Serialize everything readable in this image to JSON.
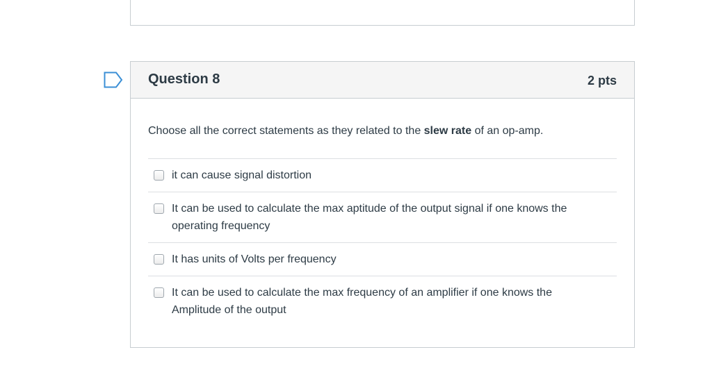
{
  "question": {
    "title": "Question 8",
    "points": "2 pts",
    "text_before": "Choose all the correct statements as they related to the ",
    "text_bold": "slew rate",
    "text_after": " of an op-amp.",
    "answers": [
      {
        "label": "it can cause signal distortion",
        "checked": false
      },
      {
        "label": "It can be used to calculate the max aptitude of the output signal if one knows the operating frequency",
        "checked": false
      },
      {
        "label": "It has units of Volts per frequency",
        "checked": false
      },
      {
        "label": "It can be used to calculate the max frequency of an amplifier if one knows the Amplitude of the output",
        "checked": false
      }
    ]
  },
  "colors": {
    "flag_stroke": "#3b8fd6",
    "border": "#c7cdd1",
    "header_bg": "#f5f5f5",
    "text": "#2d3b45"
  }
}
